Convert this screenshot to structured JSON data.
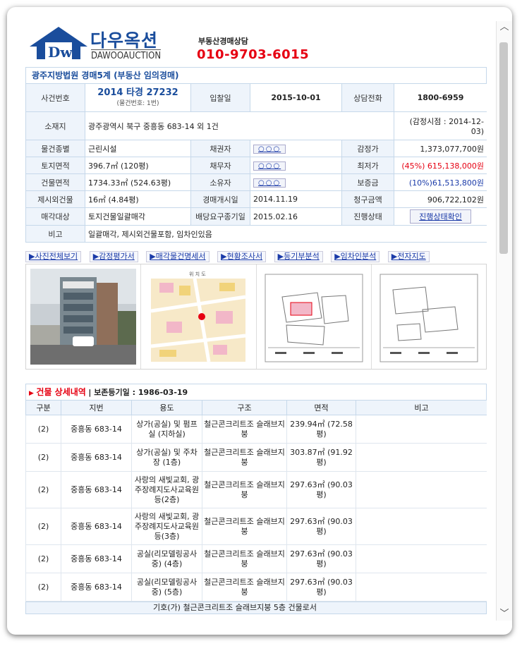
{
  "header": {
    "brand_ko": "다우옥션",
    "brand_en": "DAWOOAUCTION",
    "logo_letter": "Dw",
    "consult_label": "부동산경매상담",
    "phone": "010-9703-6015"
  },
  "court_title": "광주지방법원  경매5계 (부동산 임의경매)",
  "info": {
    "case_label": "사건번호",
    "case_number": "2014 타경 27232",
    "case_sub": "(물건번호: 1번)",
    "bid_date_label": "입찰일",
    "bid_date": "2015-10-01",
    "consult_tel_label": "상담전화",
    "consult_tel": "1800-6959",
    "location_label": "소재지",
    "location": "광주광역시 북구 중흥동 683-14 외 1건",
    "appraisal_note": "(감정시점 : 2014-12-03)",
    "rows": [
      {
        "l1": "물건종별",
        "v1": "근린시설",
        "l2": "채권자",
        "v2": "○○○",
        "l3": "감정가",
        "v3": "1,373,077,700원"
      },
      {
        "l1": "토지면적",
        "v1": "396.7㎡ (120평)",
        "l2": "채무자",
        "v2": "○○○",
        "l3": "최저가",
        "v3": "(45%) 615,138,000원"
      },
      {
        "l1": "건물면적",
        "v1": "1734.33㎡ (524.63평)",
        "l2": "소유자",
        "v2": "○○○",
        "l3": "보증금",
        "v3": "(10%)61,513,800원"
      },
      {
        "l1": "제시외건물",
        "v1": "16㎡ (4.84평)",
        "l2": "경매개시일",
        "v2": "2014.11.19",
        "l3": "청구금액",
        "v3": "906,722,102원"
      },
      {
        "l1": "매각대상",
        "v1": "토지건물일괄매각",
        "l2": "배당요구종기일",
        "v2": "2015.02.16",
        "l3": "진행상태",
        "v3": "진행상태확인"
      }
    ],
    "note_label": "비고",
    "note": "일괄매각, 제시외건물포함, 임차인있음"
  },
  "links": [
    "▶사진전체보기",
    "▶감정평가서",
    "▶매각물건명세서",
    "▶현황조사서",
    "▶등기부분석",
    "▶임차인분석",
    "▶전자지도"
  ],
  "building": {
    "title": "건물 상세내역",
    "reg_date": "| 보존등기일 : 1986-03-19",
    "headers": [
      "구분",
      "지번",
      "용도",
      "구조",
      "면적",
      "비고"
    ],
    "rows": [
      [
        "(2)",
        "중흥동 683-14",
        "상가(공실) 및 펌프실 (지하실)",
        "철근콘크리트조 슬래브지붕",
        "239.94㎡ (72.58평)",
        ""
      ],
      [
        "(2)",
        "중흥동 683-14",
        "상가(공실) 및 주차장 (1층)",
        "철근콘크리트조 슬래브지붕",
        "303.87㎡ (91.92평)",
        ""
      ],
      [
        "(2)",
        "중흥동 683-14",
        "사랑의 새빛교회, 광주장례지도사교육원등(2층)",
        "철근콘크리트조 슬래브지붕",
        "297.63㎡ (90.03평)",
        ""
      ],
      [
        "(2)",
        "중흥동 683-14",
        "사랑의 새빛교회, 광주장례지도사교육원등(3층)",
        "철근콘크리트조 슬래브지붕",
        "297.63㎡ (90.03평)",
        ""
      ],
      [
        "(2)",
        "중흥동 683-14",
        "공실(리모델링공사중) (4층)",
        "철근콘크리트조 슬래브지붕",
        "297.63㎡ (90.03평)",
        ""
      ],
      [
        "(2)",
        "중흥동 683-14",
        "공실(리모델링공사중) (5층)",
        "철근콘크리트조 슬래브지붕",
        "297.63㎡ (90.03평)",
        ""
      ]
    ],
    "footer_text": "기호(가) 철근콘크리트조 슬래브지붕 5층 건물로서"
  },
  "colors": {
    "accent": "#1a4d9c",
    "red": "#e60012",
    "label_bg": "#eef4fb"
  }
}
